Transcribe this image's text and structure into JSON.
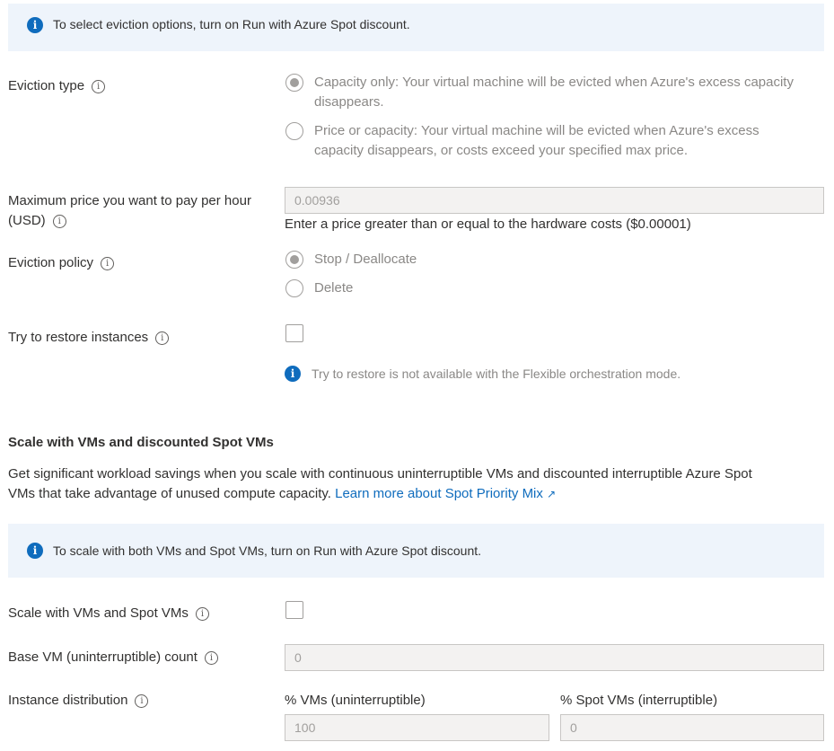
{
  "banner_eviction": {
    "text": "To select eviction options, turn on Run with Azure Spot discount."
  },
  "eviction_type": {
    "label": "Eviction type",
    "options": [
      {
        "line1": "Capacity only: Your virtual machine will be evicted when Azure's excess capacity",
        "line2": "disappears.",
        "checked": true
      },
      {
        "line1": "Price or capacity: Your virtual machine will be evicted when Azure's excess",
        "line2": "capacity disappears, or costs exceed your specified max price.",
        "checked": false
      }
    ]
  },
  "max_price": {
    "label_line1": "Maximum price you want to pay per hour",
    "label_line2": "(USD)",
    "value": "0.00936",
    "hint": "Enter a price greater than or equal to the hardware costs ($0.00001)"
  },
  "eviction_policy": {
    "label": "Eviction policy",
    "options": [
      {
        "label": "Stop / Deallocate",
        "checked": true
      },
      {
        "label": "Delete",
        "checked": false
      }
    ]
  },
  "restore": {
    "label": "Try to restore instances",
    "checked": false,
    "note": "Try to restore is not available with the Flexible orchestration mode."
  },
  "scale_section": {
    "heading": "Scale with VMs and discounted Spot VMs",
    "desc_line1": "Get significant workload savings when you scale with continuous uninterruptible VMs and discounted interruptible Azure Spot",
    "desc_line2": "VMs that take advantage of unused compute capacity.",
    "link": "Learn more about Spot Priority Mix"
  },
  "banner_scale": {
    "text": "To scale with both VMs and Spot VMs, turn on Run with Azure Spot discount."
  },
  "scale_vms": {
    "label": "Scale with VMs and Spot VMs",
    "checked": false
  },
  "base_vm": {
    "label": "Base VM (uninterruptible) count",
    "value": "0"
  },
  "distribution": {
    "label": "Instance distribution",
    "vms_label": "% VMs (uninterruptible)",
    "vms_value": "100",
    "spot_label": "% Spot VMs (interruptible)",
    "spot_value": "0"
  },
  "icons": {
    "info": "i",
    "tooltip": "i",
    "external": "↗"
  },
  "colors": {
    "accent": "#0f6cbd",
    "banner_bg": "#eef4fb",
    "disabled_text": "#8a8886"
  }
}
